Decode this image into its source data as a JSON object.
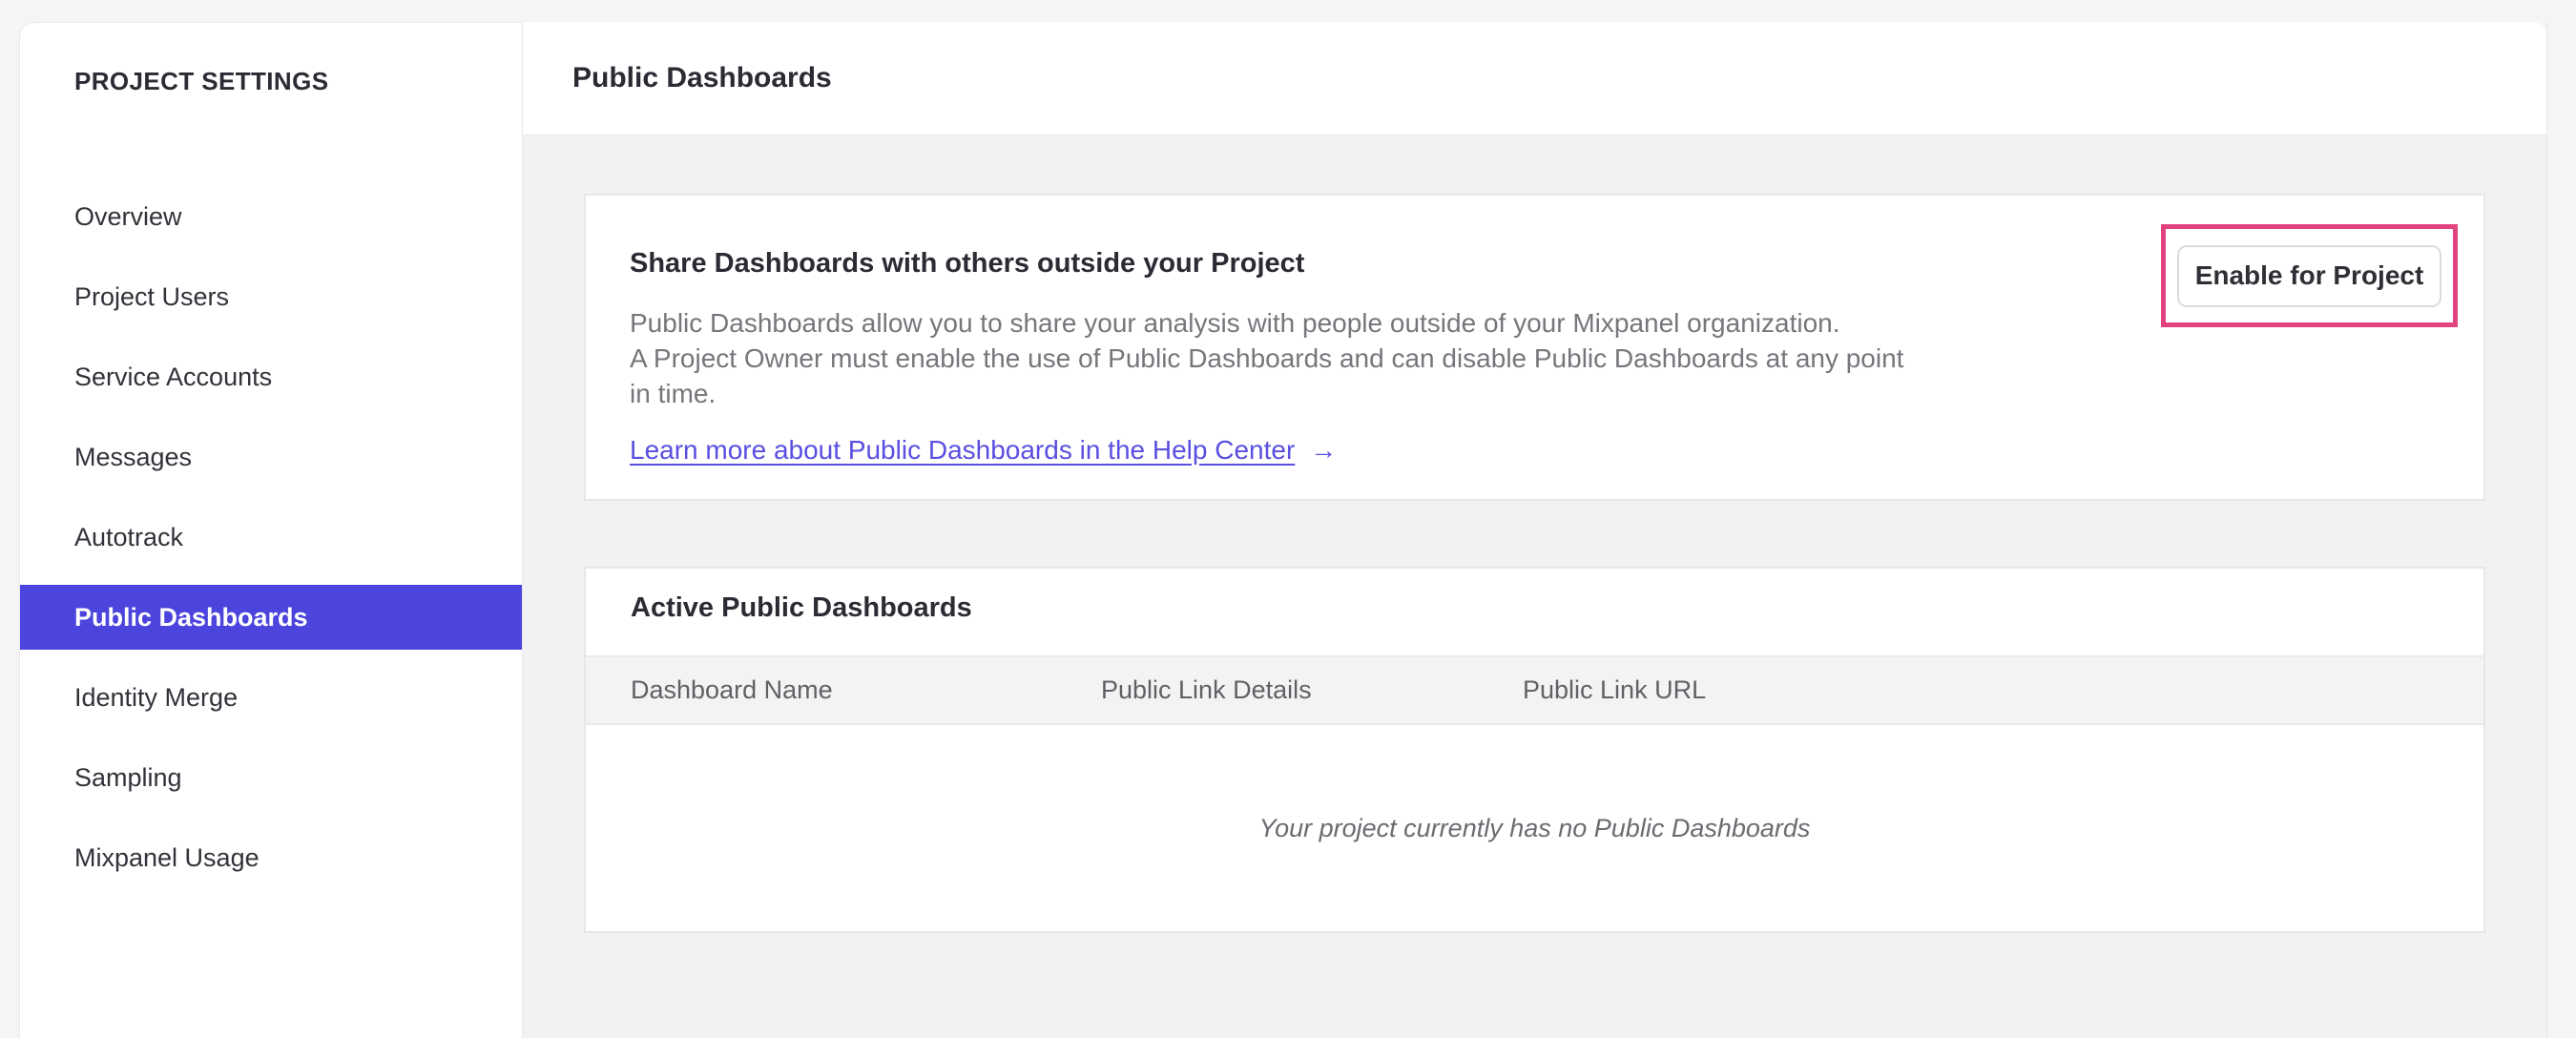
{
  "sidebar": {
    "title": "PROJECT SETTINGS",
    "items": [
      {
        "label": "Overview",
        "active": false
      },
      {
        "label": "Project Users",
        "active": false
      },
      {
        "label": "Service Accounts",
        "active": false
      },
      {
        "label": "Messages",
        "active": false
      },
      {
        "label": "Autotrack",
        "active": false
      },
      {
        "label": "Public Dashboards",
        "active": true
      },
      {
        "label": "Identity Merge",
        "active": false
      },
      {
        "label": "Sampling",
        "active": false
      },
      {
        "label": "Mixpanel Usage",
        "active": false
      }
    ]
  },
  "header": {
    "title": "Public Dashboards"
  },
  "share_card": {
    "title": "Share Dashboards with others outside your Project",
    "body_lines": [
      "Public Dashboards allow you to share your analysis with people outside of your Mixpanel organization.",
      "A Project Owner must enable the use of Public Dashboards and can disable Public Dashboards at any point",
      "in time."
    ],
    "link_label": "Learn more about Public Dashboards in the Help Center",
    "link_arrow": "→",
    "button_label": "Enable for Project"
  },
  "active_card": {
    "title": "Active Public Dashboards",
    "columns": [
      "Dashboard Name",
      "Public Link Details",
      "Public Link URL"
    ],
    "empty_message": "Your project currently has no Public Dashboards"
  },
  "colors": {
    "sidebar_active_bg": "#4b44dd",
    "link": "#5a4fe0",
    "highlight_border": "#e2427f",
    "content_bg": "#f2f2f4",
    "card_border": "#e7e7ea"
  }
}
